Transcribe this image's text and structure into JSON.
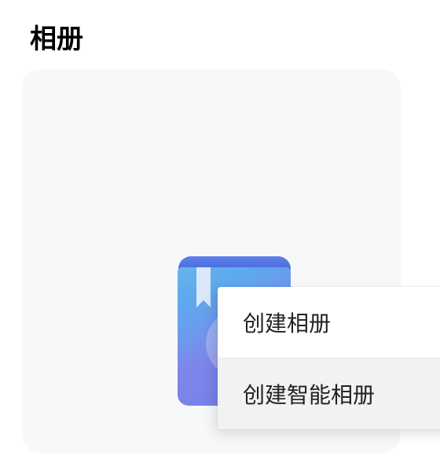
{
  "page": {
    "title": "相册"
  },
  "album_card": {
    "icon_name": "add-album-book-icon"
  },
  "context_menu": {
    "items": [
      {
        "label": "创建相册"
      },
      {
        "label": "创建智能相册"
      }
    ]
  },
  "colors": {
    "card_bg": "#f7f8f9",
    "book_gradient_start": "#7b9af5",
    "book_gradient_end": "#6f7de7",
    "bookmark": "#dbe7fb",
    "menu_hover": "#f1f2f3"
  }
}
